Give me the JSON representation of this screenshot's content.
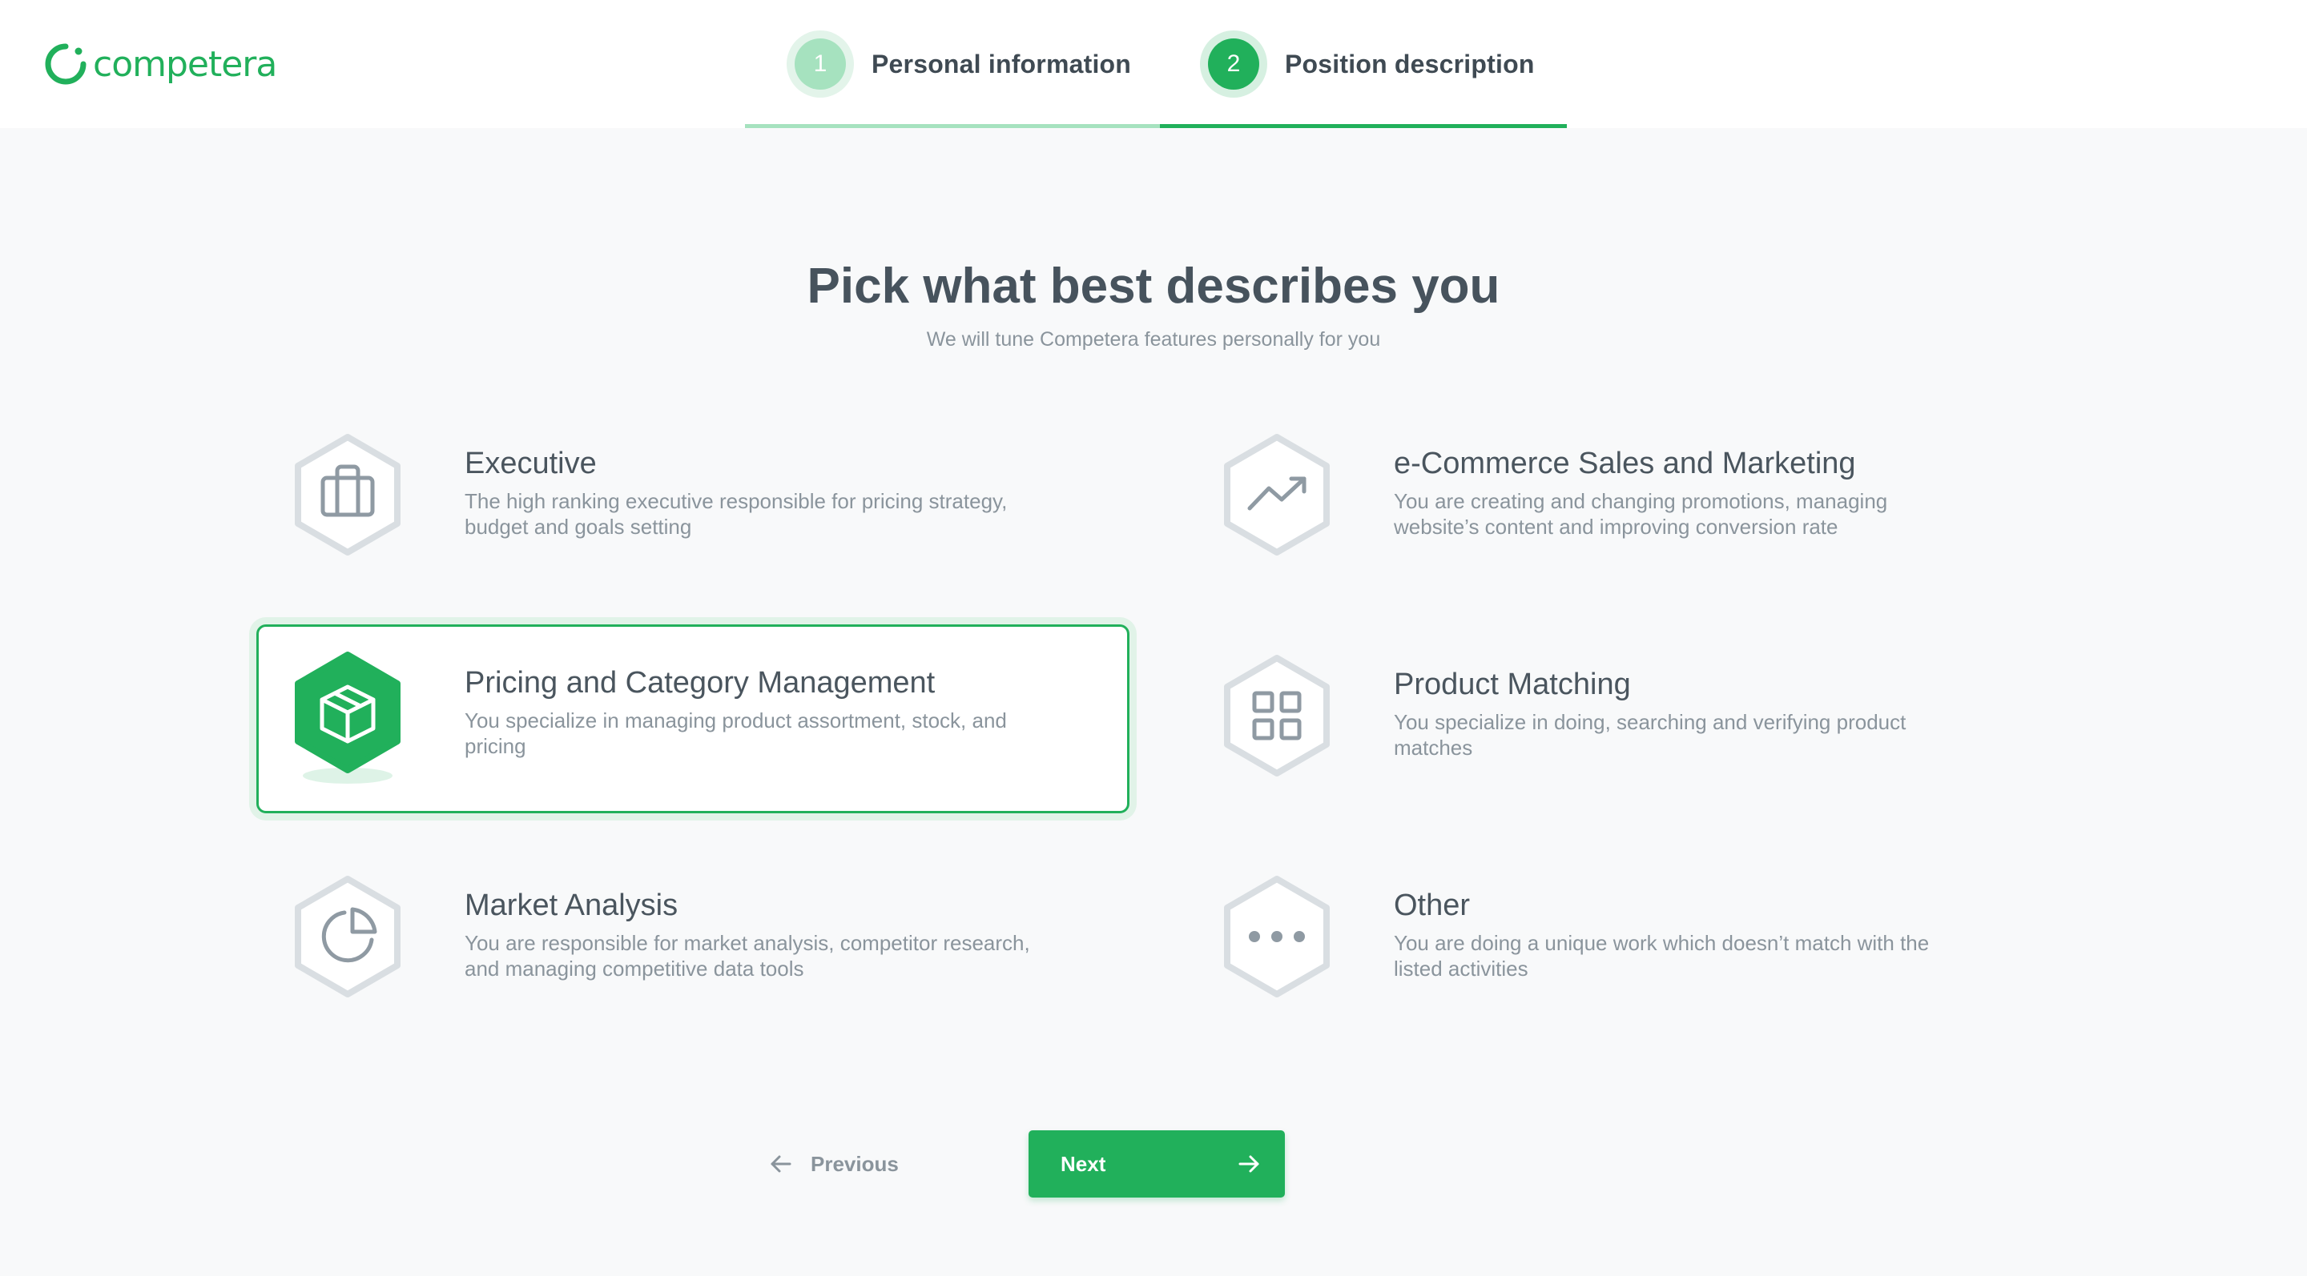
{
  "brand": {
    "name": "competera",
    "color": "#21b05b"
  },
  "steps": [
    {
      "number": "1",
      "label": "Personal information",
      "state": "completed"
    },
    {
      "number": "2",
      "label": "Position description",
      "state": "active"
    }
  ],
  "main": {
    "title": "Pick what best describes you",
    "subtitle": "We will tune Competera features personally for you"
  },
  "options": [
    {
      "icon": "briefcase-icon",
      "title": "Executive",
      "description": "The high ranking executive responsible for pricing strategy, budget and goals setting",
      "selected": false
    },
    {
      "icon": "trending-up-icon",
      "title": "e-Commerce Sales and Marketing",
      "description": "You are creating and changing promotions, managing website’s content and improving conversion rate",
      "selected": false
    },
    {
      "icon": "box-icon",
      "title": "Pricing and Category Management",
      "description": "You specialize in managing product assortment, stock, and pricing",
      "selected": true
    },
    {
      "icon": "grid-icon",
      "title": "Product Matching",
      "description": "You specialize in doing, searching and verifying product matches",
      "selected": false
    },
    {
      "icon": "pie-chart-icon",
      "title": "Market Analysis",
      "description": "You are responsible for market analysis, competitor research, and managing competitive data tools",
      "selected": false
    },
    {
      "icon": "more-dots-icon",
      "title": "Other",
      "description": "You are doing a unique work which doesn’t match with the listed activities",
      "selected": false
    }
  ],
  "nav": {
    "previous_label": "Previous",
    "next_label": "Next"
  },
  "colors": {
    "accent": "#21b05b",
    "accent_light": "#a6e2bf",
    "text": "#4a555e",
    "muted": "#8a949c",
    "background": "#f8f9fa"
  }
}
